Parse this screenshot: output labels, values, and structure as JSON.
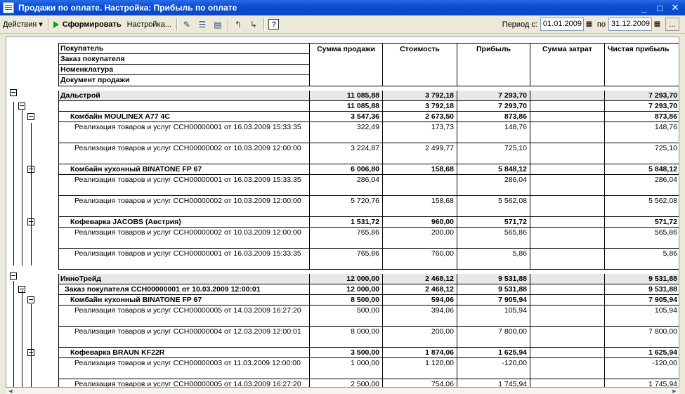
{
  "window": {
    "title": "Продажи по оплате. Настройка: Прибыль по оплате",
    "minimize": "_",
    "maximize": "□",
    "close": "✕"
  },
  "toolbar": {
    "actions_label": "Действия ▾",
    "generate_label": "Сформировать",
    "settings_label": "Настройка...",
    "help_label": "?",
    "period_from_label": "Период с:",
    "period_from": "01.01.2009",
    "period_to_label": "по",
    "period_to": "31.12.2009",
    "more_label": "..."
  },
  "header": {
    "groupings": [
      "Покупатель",
      "Заказ покупателя",
      "Номенклатура",
      "Документ продажи"
    ],
    "columns": [
      "Сумма продажи",
      "Стоимость",
      "Прибыль",
      "Сумма затрат",
      "Чистая прибыль"
    ]
  },
  "rows": [
    {
      "name": "Дальстрой",
      "bold": true,
      "shade": true,
      "indent": 0,
      "v": [
        "11 085,88",
        "3 792,18",
        "7 293,70",
        "",
        "7 293,70"
      ]
    },
    {
      "name": "",
      "bold": true,
      "shade": false,
      "indent": 0,
      "v": [
        "11 085,88",
        "3 792,18",
        "7 293,70",
        "",
        "7 293,70"
      ]
    },
    {
      "name": "Комбайн MOULINEX  A77 4C",
      "bold": true,
      "shade": false,
      "indent": 14,
      "v": [
        "3 547,36",
        "2 673,50",
        "873,86",
        "",
        "873,86"
      ]
    },
    {
      "name": "Реализация товаров и услуг ССН00000001 от 16.03.2009 15:33:35",
      "bold": false,
      "shade": false,
      "indent": 20,
      "v": [
        "322,49",
        "173,73",
        "148,76",
        "",
        "148,76"
      ]
    },
    {
      "name": "Реализация товаров и услуг ССН00000002 от 10.03.2009 12:00:00",
      "bold": false,
      "shade": false,
      "indent": 20,
      "v": [
        "3 224,87",
        "2 499,77",
        "725,10",
        "",
        "725,10"
      ]
    },
    {
      "name": "Комбайн кухонный BINATONE FP 67",
      "bold": true,
      "shade": false,
      "indent": 14,
      "v": [
        "6 006,80",
        "158,68",
        "5 848,12",
        "",
        "5 848,12"
      ]
    },
    {
      "name": "Реализация товаров и услуг ССН00000001 от 16.03.2009 15:33:35",
      "bold": false,
      "shade": false,
      "indent": 20,
      "v": [
        "286,04",
        "",
        "286,04",
        "",
        "286,04"
      ]
    },
    {
      "name": "Реализация товаров и услуг ССН00000002 от 10.03.2009 12:00:00",
      "bold": false,
      "shade": false,
      "indent": 20,
      "v": [
        "5 720,76",
        "158,68",
        "5 562,08",
        "",
        "5 562,08"
      ]
    },
    {
      "name": "Кофеварка JACOBS (Австрия)",
      "bold": true,
      "shade": false,
      "indent": 14,
      "v": [
        "1 531,72",
        "960,00",
        "571,72",
        "",
        "571,72"
      ]
    },
    {
      "name": "Реализация товаров и услуг ССН00000002 от 10.03.2009 12:00:00",
      "bold": false,
      "shade": false,
      "indent": 20,
      "v": [
        "765,86",
        "200,00",
        "565,86",
        "",
        "565,86"
      ]
    },
    {
      "name": "Реализация товаров и услуг ССН00000001 от 16.03.2009 15:33:35",
      "bold": false,
      "shade": false,
      "indent": 20,
      "v": [
        "765,86",
        "760,00",
        "5,86",
        "",
        "5,86"
      ]
    },
    {
      "name": "ИнноТрейд",
      "bold": true,
      "shade": true,
      "indent": 0,
      "v": [
        "12 000,00",
        "2 468,12",
        "9 531,88",
        "",
        "9 531,88"
      ]
    },
    {
      "name": "Заказ покупателя ССН00000001 от 10.03.2009 12:00:01",
      "bold": true,
      "shade": false,
      "indent": 6,
      "v": [
        "12 000,00",
        "2 468,12",
        "9 531,88",
        "",
        "9 531,88"
      ]
    },
    {
      "name": "Комбайн кухонный BINATONE FP 67",
      "bold": true,
      "shade": false,
      "indent": 14,
      "v": [
        "8 500,00",
        "594,06",
        "7 905,94",
        "",
        "7 905,94"
      ]
    },
    {
      "name": "Реализация товаров и услуг ССН00000005 от 14.03.2009 16:27:20",
      "bold": false,
      "shade": false,
      "indent": 20,
      "v": [
        "500,00",
        "394,06",
        "105,94",
        "",
        "105,94"
      ]
    },
    {
      "name": "Реализация товаров и услуг ССН00000004 от 12.03.2009 12:00:01",
      "bold": false,
      "shade": false,
      "indent": 20,
      "v": [
        "8 000,00",
        "200,00",
        "7 800,00",
        "",
        "7 800,00"
      ]
    },
    {
      "name": "Кофеварка BRAUN KF22R",
      "bold": true,
      "shade": false,
      "indent": 14,
      "v": [
        "3 500,00",
        "1 874,06",
        "1 625,94",
        "",
        "1 625,94"
      ]
    },
    {
      "name": "Реализация товаров и услуг ССН00000003 от 11.03.2009 12:00:00",
      "bold": false,
      "shade": false,
      "indent": 20,
      "v": [
        "1 000,00",
        "1 120,00",
        "-120,00",
        "",
        "-120,00"
      ]
    },
    {
      "name": "Реализация товаров и услуг ССН00000005 от 14.03.2009 16:27:20",
      "bold": false,
      "shade": false,
      "indent": 20,
      "v": [
        "2 500,00",
        "754,06",
        "1 745,94",
        "",
        "1 745,94"
      ]
    }
  ]
}
